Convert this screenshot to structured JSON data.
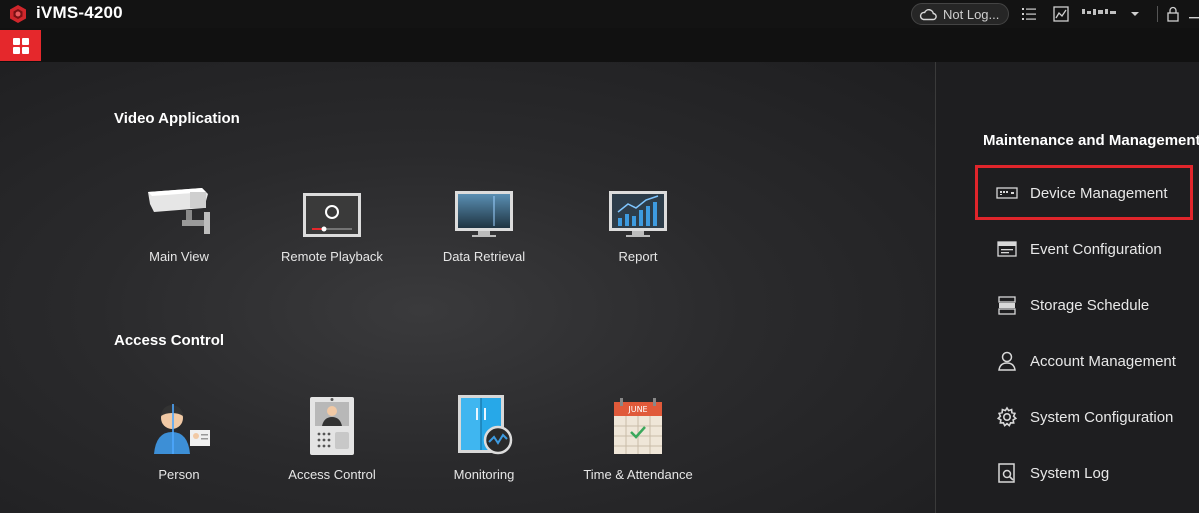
{
  "app": {
    "title": "iVMS-4200"
  },
  "titlebar": {
    "login_status": "Not Log...",
    "user_text": "····",
    "icons": [
      "cloud-icon",
      "list-icon",
      "chart-icon",
      "chevron-down-icon",
      "lock-icon",
      "minimize-icon"
    ]
  },
  "colors": {
    "accent": "#e5282c",
    "highlight": "#e0252b",
    "background": "#1c1c1e"
  },
  "video_application": {
    "title": "Video Application",
    "tiles": [
      {
        "label": "Main View",
        "icon": "camera-icon"
      },
      {
        "label": "Remote Playback",
        "icon": "playback-icon"
      },
      {
        "label": "Data Retrieval",
        "icon": "monitor-icon"
      },
      {
        "label": "Report",
        "icon": "report-chart-icon"
      }
    ]
  },
  "access_control": {
    "title": "Access Control",
    "tiles": [
      {
        "label": "Person",
        "icon": "person-card-icon"
      },
      {
        "label": "Access Control",
        "icon": "door-station-icon"
      },
      {
        "label": "Monitoring",
        "icon": "door-monitor-icon"
      },
      {
        "label": "Time & Attendance",
        "icon": "calendar-icon"
      }
    ],
    "calendar_month": "JUNE"
  },
  "maintenance": {
    "title": "Maintenance and Management",
    "items": [
      {
        "label": "Device Management",
        "icon": "device-icon",
        "highlighted": true
      },
      {
        "label": "Event Configuration",
        "icon": "event-icon"
      },
      {
        "label": "Storage Schedule",
        "icon": "storage-icon"
      },
      {
        "label": "Account Management",
        "icon": "account-icon"
      },
      {
        "label": "System Configuration",
        "icon": "gear-icon"
      },
      {
        "label": "System Log",
        "icon": "log-icon"
      }
    ]
  }
}
